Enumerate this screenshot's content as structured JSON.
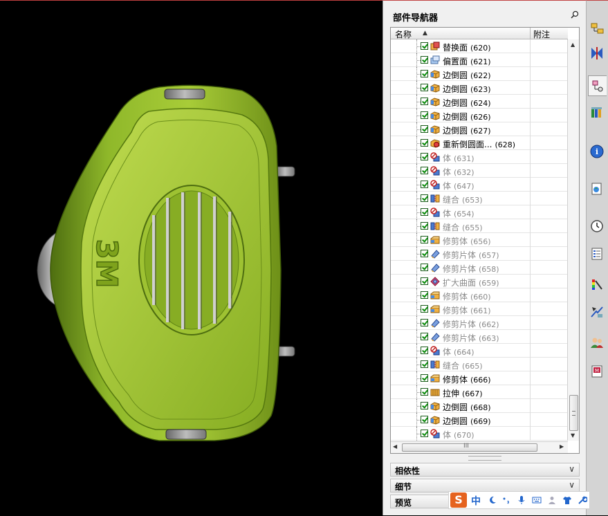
{
  "viewport": {
    "model_logo": "3M",
    "colors": {
      "background": "#000000",
      "body": "#8fb82a",
      "body_light": "#b8d24a",
      "frame": "#9a9a9a"
    }
  },
  "navigator": {
    "title": "部件导航器",
    "columns": {
      "name": "名称",
      "note": "附注"
    },
    "rows": [
      {
        "label": "替换面",
        "num": "(620)",
        "icon": "replace-face-icon",
        "dim": false
      },
      {
        "label": "偏置面",
        "num": "(621)",
        "icon": "offset-face-icon",
        "dim": false
      },
      {
        "label": "边倒圆",
        "num": "(622)",
        "icon": "edge-blend-icon",
        "dim": false
      },
      {
        "label": "边倒圆",
        "num": "(623)",
        "icon": "edge-blend-icon",
        "dim": false
      },
      {
        "label": "边倒圆",
        "num": "(624)",
        "icon": "edge-blend-icon",
        "dim": false
      },
      {
        "label": "边倒圆",
        "num": "(626)",
        "icon": "edge-blend-icon",
        "dim": false
      },
      {
        "label": "边倒圆",
        "num": "(627)",
        "icon": "edge-blend-icon",
        "dim": false
      },
      {
        "label": "重新倒圆面...",
        "num": "(628)",
        "icon": "reblend-face-icon",
        "dim": false
      },
      {
        "label": "体",
        "num": "(631)",
        "icon": "body-icon",
        "dim": true
      },
      {
        "label": "体",
        "num": "(632)",
        "icon": "body-icon",
        "dim": true
      },
      {
        "label": "体",
        "num": "(647)",
        "icon": "body-icon",
        "dim": true
      },
      {
        "label": "缝合",
        "num": "(653)",
        "icon": "sew-icon",
        "dim": true
      },
      {
        "label": "体",
        "num": "(654)",
        "icon": "body-icon",
        "dim": true
      },
      {
        "label": "缝合",
        "num": "(655)",
        "icon": "sew-icon",
        "dim": true
      },
      {
        "label": "修剪体",
        "num": "(656)",
        "icon": "trim-body-icon",
        "dim": true
      },
      {
        "label": "修剪片体",
        "num": "(657)",
        "icon": "trim-sheet-icon",
        "dim": true
      },
      {
        "label": "修剪片体",
        "num": "(658)",
        "icon": "trim-sheet-icon",
        "dim": true
      },
      {
        "label": "扩大曲面",
        "num": "(659)",
        "icon": "enlarge-surface-icon",
        "dim": true
      },
      {
        "label": "修剪体",
        "num": "(660)",
        "icon": "trim-body-icon",
        "dim": true
      },
      {
        "label": "修剪体",
        "num": "(661)",
        "icon": "trim-body-icon",
        "dim": true
      },
      {
        "label": "修剪片体",
        "num": "(662)",
        "icon": "trim-sheet-icon",
        "dim": true
      },
      {
        "label": "修剪片体",
        "num": "(663)",
        "icon": "trim-sheet-icon",
        "dim": true
      },
      {
        "label": "体",
        "num": "(664)",
        "icon": "body-icon",
        "dim": true
      },
      {
        "label": "缝合",
        "num": "(665)",
        "icon": "sew-icon",
        "dim": true
      },
      {
        "label": "修剪体",
        "num": "(666)",
        "icon": "trim-body-icon",
        "dim": false
      },
      {
        "label": "拉伸",
        "num": "(667)",
        "icon": "extrude-icon",
        "dim": false
      },
      {
        "label": "边倒圆",
        "num": "(668)",
        "icon": "edge-blend-icon",
        "dim": false
      },
      {
        "label": "边倒圆",
        "num": "(669)",
        "icon": "edge-blend-icon",
        "dim": false
      },
      {
        "label": "体",
        "num": "(670)",
        "icon": "body-icon",
        "dim": true
      }
    ],
    "hscroll_marker": "III",
    "sections": [
      {
        "label": "相依性"
      },
      {
        "label": "细节"
      },
      {
        "label": "预览"
      }
    ]
  },
  "sidebar": {
    "items": [
      "assembly-navigator-icon",
      "constraint-navigator-icon",
      "part-navigator-icon",
      "reuse-library-icon",
      "hd3d-tools-icon",
      "web-browser-icon",
      "history-icon",
      "process-studio-icon",
      "visual-report-icon",
      "manufacturing-wizard-icon",
      "roles-icon",
      "system-materials-icon"
    ],
    "active_index": 2
  },
  "ime_toolbar": {
    "logo": "S",
    "mode": "中"
  }
}
